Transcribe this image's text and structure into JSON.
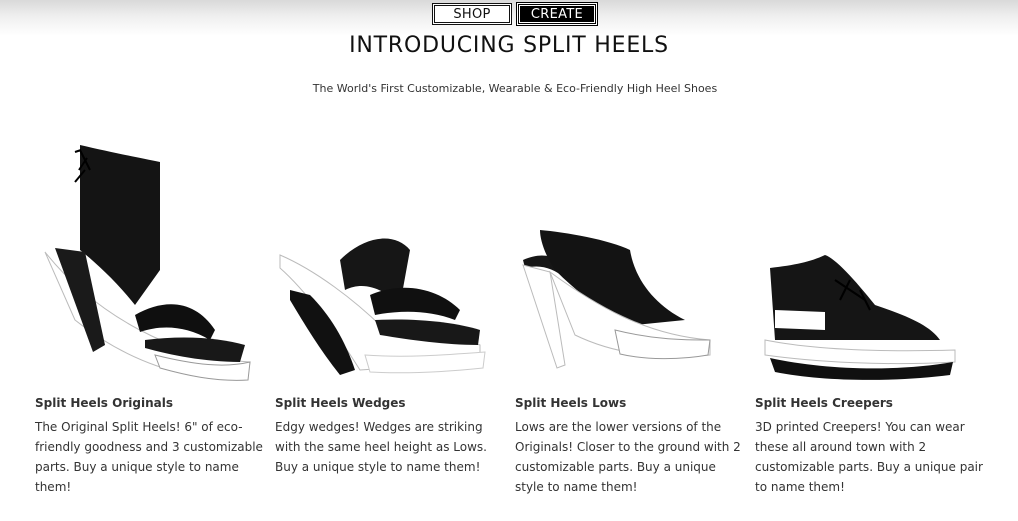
{
  "nav": {
    "shop_label": "SHOP",
    "create_label": "CREATE"
  },
  "header": {
    "title": "INTRODUCING SPLIT HEELS",
    "subtitle": "The World's First Customizable, Wearable & Eco-Friendly High Heel Shoes"
  },
  "products": [
    {
      "name": "Split Heels Originals",
      "description": "The Original Split Heels! 6\" of eco-friendly goodness and 3 customizable parts. Buy a unique style to name them!"
    },
    {
      "name": "Split Heels Wedges",
      "description": "Edgy wedges! Wedges are striking with the same heel height as Lows. Buy a unique style to name them!"
    },
    {
      "name": "Split Heels Lows",
      "description": "Lows are the lower versions of the Originals! Closer to the ground with 2 customizable parts. Buy a unique style to name them!"
    },
    {
      "name": "Split Heels Creepers",
      "description": "3D printed Creepers! You can wear these all around town with 2 customizable parts. Buy a unique pair to name them!"
    }
  ],
  "colors": {
    "shoe_black": "#111111",
    "sole_white": "#ffffff",
    "text": "#333333"
  }
}
